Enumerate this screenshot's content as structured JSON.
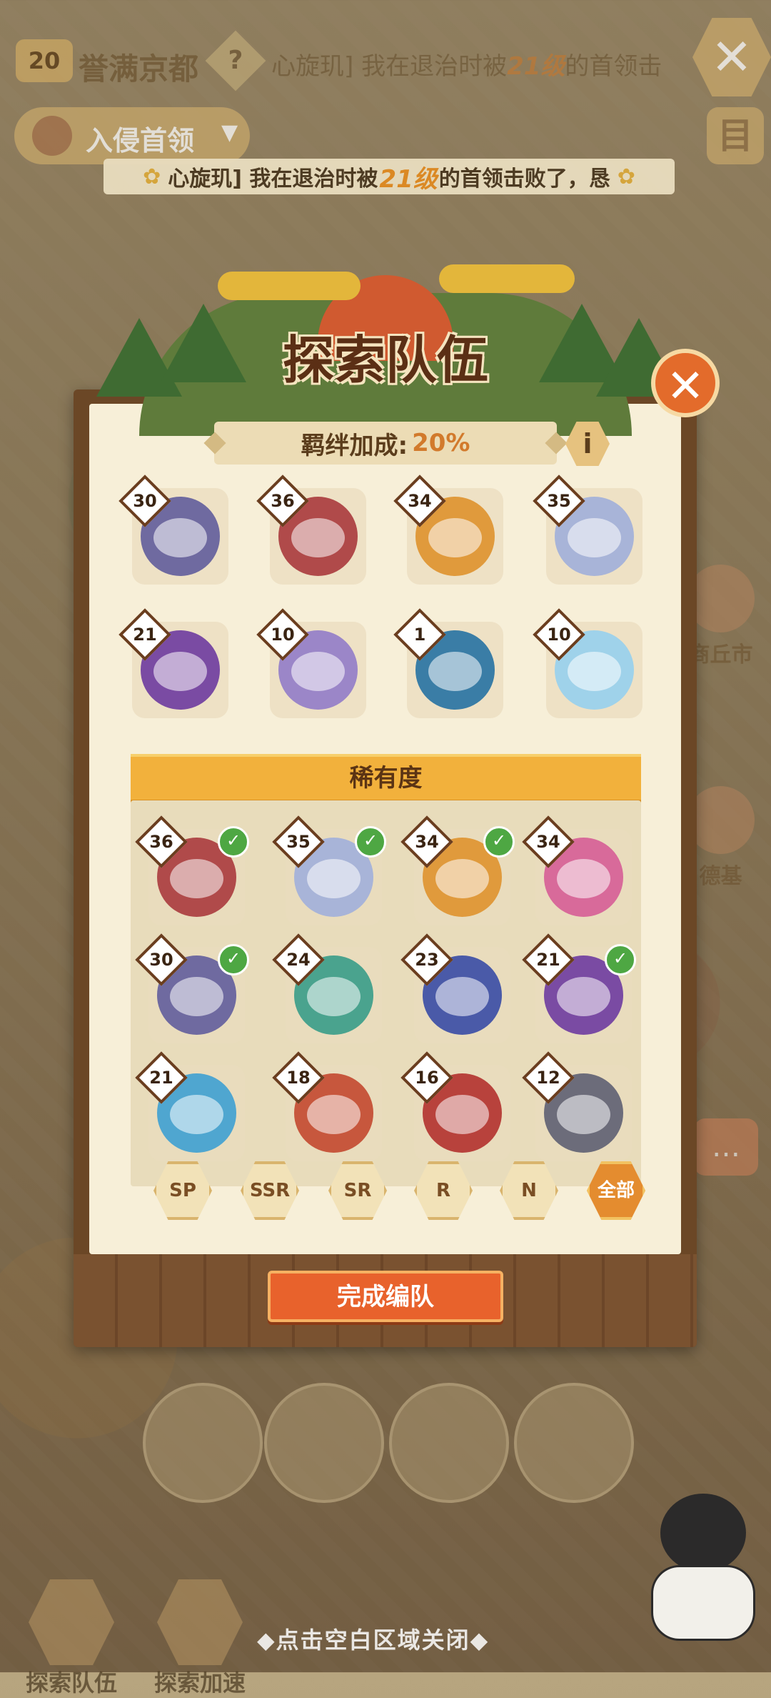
{
  "topbar": {
    "level": "20",
    "city": "誉满京都",
    "help_glyph": "?",
    "ticker_pre": "心旋玑] 我在退治时被",
    "ticker_num": "21级",
    "ticker_post": "的首领击",
    "close_glyph": "✕"
  },
  "invade": {
    "label": "入侵首领",
    "arrow": "▼"
  },
  "menu_glyph": "目",
  "ticker": {
    "pre": "心旋玑] 我在退治时被",
    "num": "21级",
    "post": "的首领击败了，恳"
  },
  "side": {
    "city1": "商丘市",
    "city2": "德基"
  },
  "modal": {
    "title": "探索队伍",
    "close_glyph": "✕",
    "bond_label": "羁绊加成:",
    "bond_value": "20%",
    "info_glyph": "i",
    "team": [
      {
        "level": "30",
        "color": "#6f6aa0"
      },
      {
        "level": "36",
        "color": "#b04a4a"
      },
      {
        "level": "34",
        "color": "#e09a3c"
      },
      {
        "level": "35",
        "color": "#a8b4d8"
      },
      {
        "level": "21",
        "color": "#7a4ba3"
      },
      {
        "level": "10",
        "color": "#9b86c8"
      },
      {
        "level": "1",
        "color": "#3a7da6"
      },
      {
        "level": "10",
        "color": "#9fd2ea"
      }
    ],
    "rarity_title": "稀有度",
    "roster": [
      {
        "level": "36",
        "color": "#b04a4a",
        "checked": true
      },
      {
        "level": "35",
        "color": "#a8b4d8",
        "checked": true
      },
      {
        "level": "34",
        "color": "#e09a3c",
        "checked": true
      },
      {
        "level": "34",
        "color": "#d86a9a",
        "checked": false
      },
      {
        "level": "30",
        "color": "#6f6aa0",
        "checked": true
      },
      {
        "level": "24",
        "color": "#4aa38e",
        "checked": false
      },
      {
        "level": "23",
        "color": "#4a5aa8",
        "checked": false
      },
      {
        "level": "21",
        "color": "#7a4ba3",
        "checked": true
      },
      {
        "level": "21",
        "color": "#4fa6d0",
        "checked": false
      },
      {
        "level": "18",
        "color": "#c7573d",
        "checked": false
      },
      {
        "level": "16",
        "color": "#b8423c",
        "checked": false
      },
      {
        "level": "12",
        "color": "#6c6c7a",
        "checked": false
      }
    ],
    "filters": [
      "SP",
      "SSR",
      "SR",
      "R",
      "N",
      "全部"
    ],
    "active_filter": "全部",
    "complete_label": "完成编队"
  },
  "bottom": {
    "tab1": "探索队伍",
    "tab2": "探索加速",
    "close_hint": "◆点击空白区域关闭◆"
  }
}
